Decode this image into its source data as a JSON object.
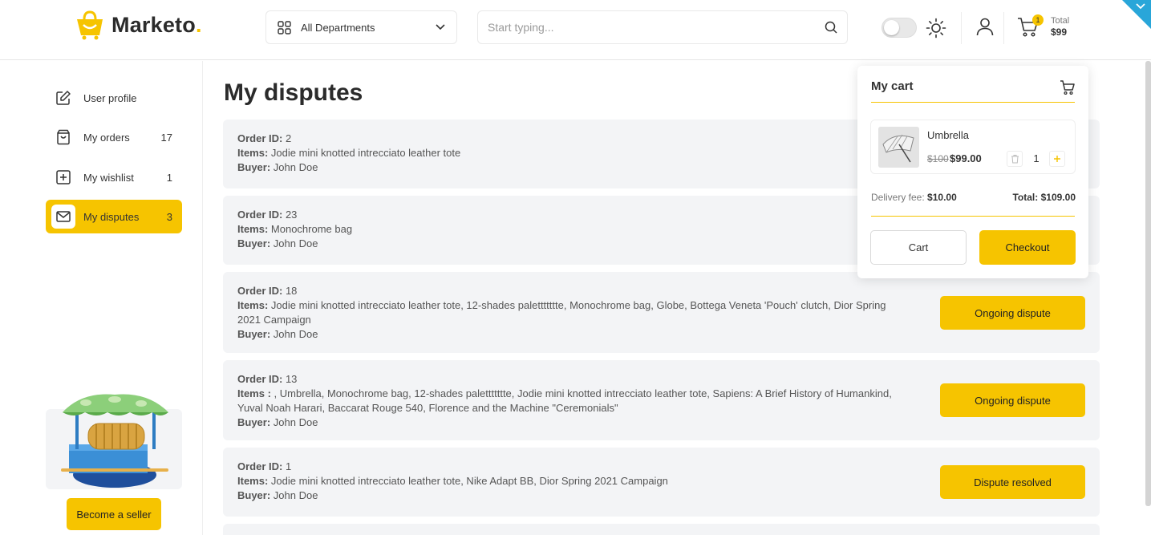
{
  "brand": {
    "name": "Marketo",
    "dot": "."
  },
  "header": {
    "department": "All Departments",
    "search_placeholder": "Start typing...",
    "cart_badge": "1",
    "total_label": "Total",
    "total_amount": "$99"
  },
  "sidebar": {
    "items": [
      {
        "label": "User profile",
        "count": ""
      },
      {
        "label": "My orders",
        "count": "17"
      },
      {
        "label": "My wishlist",
        "count": "1"
      },
      {
        "label": "My disputes",
        "count": "3"
      }
    ],
    "seller_button": "Become a seller"
  },
  "main": {
    "title": "My disputes",
    "labels": {
      "order_id": "Order ID:",
      "items": "Items:",
      "items_alt": "Items :",
      "buyer": "Buyer:"
    },
    "disputes": [
      {
        "order_id": " 2",
        "items": " Jodie mini knotted intrecciato leather tote",
        "buyer": " John Doe",
        "status": ""
      },
      {
        "order_id": " 23",
        "items": " Monochrome bag",
        "buyer": " John Doe",
        "status": ""
      },
      {
        "order_id": " 18",
        "items": " Jodie mini knotted intrecciato leather tote, 12-shades palettttttte, Monochrome bag, Globe, Bottega Veneta 'Pouch' clutch, Dior Spring 2021 Campaign",
        "buyer": " John Doe",
        "status": "Ongoing dispute"
      },
      {
        "order_id": " 13",
        "items": " , Umbrella, Monochrome bag, 12-shades palettttttte, Jodie mini knotted intrecciato leather tote, Sapiens: A Brief History of Humankind, Yuval Noah Harari, Baccarat Rouge 540, Florence and the Machine \"Ceremonials\"",
        "buyer": " John Doe",
        "status": "Ongoing dispute"
      },
      {
        "order_id": " 1",
        "items": " Jodie mini knotted intrecciato leather tote, Nike Adapt BB, Dior Spring 2021 Campaign",
        "buyer": " John Doe",
        "status": "Dispute resolved"
      }
    ]
  },
  "cart_popup": {
    "title": "My cart",
    "product": {
      "name": "Umbrella",
      "old_price": "$100",
      "price": "$99.00",
      "qty": "1"
    },
    "delivery_label": "Delivery fee:",
    "delivery_value": "$10.00",
    "total_label": "Total:",
    "total_value": "$109.00",
    "cart_button": "Cart",
    "checkout_button": "Checkout"
  },
  "colors": {
    "accent": "#f6c400",
    "card_bg": "#f3f4f6",
    "corner": "#29a6d9"
  }
}
